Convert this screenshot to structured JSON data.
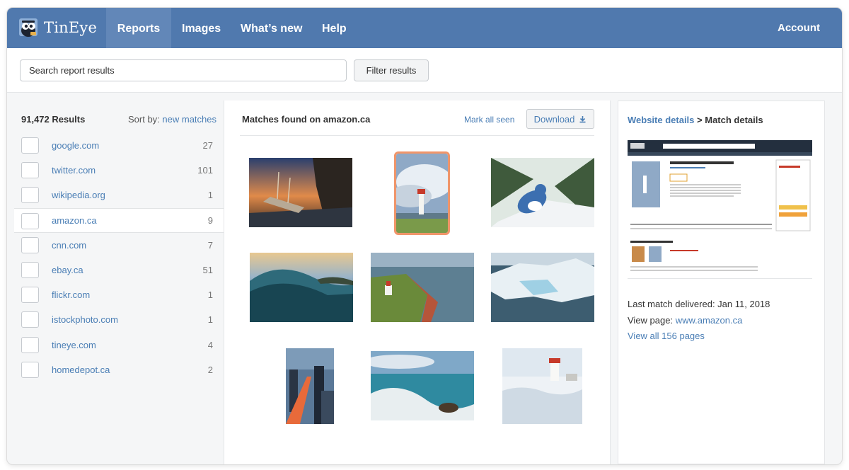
{
  "brand": {
    "name": "TinEye",
    "logo_icon": "tineye-mascot-icon"
  },
  "nav": {
    "items": [
      {
        "label": "Reports",
        "active": true
      },
      {
        "label": "Images",
        "active": false
      },
      {
        "label": "What’s new",
        "active": false
      },
      {
        "label": "Help",
        "active": false
      }
    ],
    "account_label": "Account"
  },
  "search": {
    "placeholder": "Search report results",
    "filter_label": "Filter results"
  },
  "results": {
    "count_label": "91,472 Results",
    "sort_prefix": "Sort by:",
    "sort_value": "new matches",
    "sites": [
      {
        "name": "google.com",
        "count": "27",
        "selected": false
      },
      {
        "name": "twitter.com",
        "count": "101",
        "selected": false
      },
      {
        "name": "wikipedia.org",
        "count": "1",
        "selected": false
      },
      {
        "name": "amazon.ca",
        "count": "9",
        "selected": true
      },
      {
        "name": "cnn.com",
        "count": "7",
        "selected": false
      },
      {
        "name": "ebay.ca",
        "count": "51",
        "selected": false
      },
      {
        "name": "flickr.com",
        "count": "1",
        "selected": false
      },
      {
        "name": "istockphoto.com",
        "count": "1",
        "selected": false
      },
      {
        "name": "tineye.com",
        "count": "4",
        "selected": false
      },
      {
        "name": "homedepot.ca",
        "count": "2",
        "selected": false
      }
    ]
  },
  "matches": {
    "title": "Matches found on amazon.ca",
    "mark_all_seen": "Mark all seen",
    "download_label": "Download",
    "images": [
      {
        "subject": "shipwreck-at-dusk",
        "selected": false
      },
      {
        "subject": "lighthouse-under-clouds",
        "selected": true
      },
      {
        "subject": "blue-jay-in-snow",
        "selected": false
      },
      {
        "subject": "ocean-wave",
        "selected": false
      },
      {
        "subject": "lighthouse-on-red-cliffs",
        "selected": false
      },
      {
        "subject": "iceberg",
        "selected": false
      },
      {
        "subject": "city-at-night",
        "selected": false
      },
      {
        "subject": "waves-on-rocks",
        "selected": false
      },
      {
        "subject": "snowy-lighthouse",
        "selected": false
      }
    ]
  },
  "details": {
    "breadcrumb_link": "Website details",
    "breadcrumb_sep": " > ",
    "breadcrumb_current": "Match details",
    "last_match": "Last match delivered: Jan 11, 2018",
    "view_page_prefix": "View page: ",
    "view_page_link": "www.amazon.ca",
    "view_all": "View all 156 pages"
  },
  "colors": {
    "header": "#5079ae",
    "header_active": "#6287b8",
    "link": "#4a7eb5",
    "selected_outline": "#f0956a"
  }
}
